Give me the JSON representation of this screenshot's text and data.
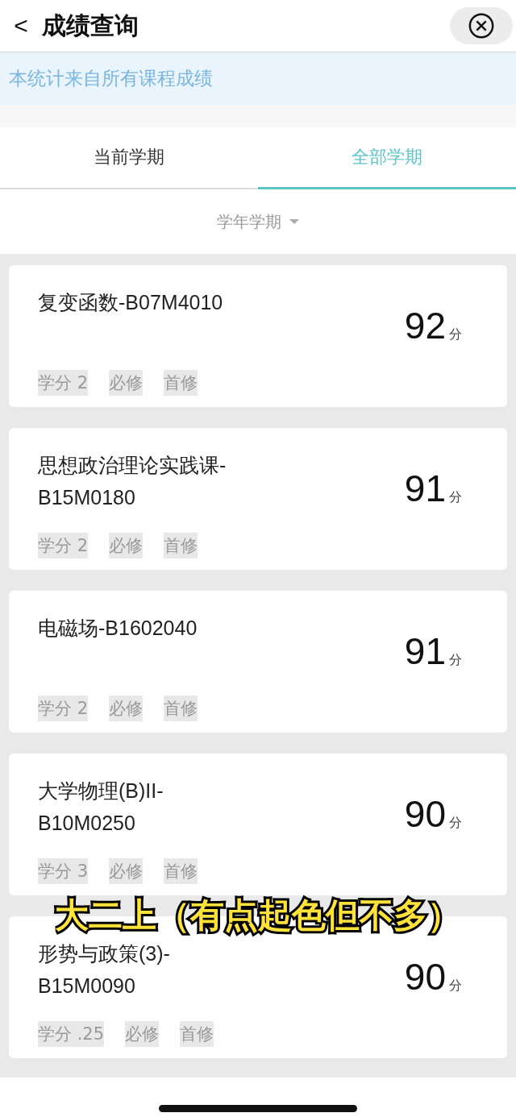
{
  "header": {
    "back": "<",
    "title": "成绩查询"
  },
  "notice": "本统计来自所有课程成绩",
  "tabs": [
    {
      "label": "当前学期",
      "selected": false
    },
    {
      "label": "全部学期",
      "selected": true
    }
  ],
  "filter": {
    "label": "学年学期"
  },
  "courses": [
    {
      "name": "复变函数-B07M4010",
      "score": "92",
      "unit": "分",
      "tags": [
        "学分 2",
        "必修",
        "首修"
      ]
    },
    {
      "name": "思想政治理论实践课-B15M0180",
      "score": "91",
      "unit": "分",
      "tags": [
        "学分 2",
        "必修",
        "首修"
      ]
    },
    {
      "name": "电磁场-B1602040",
      "score": "91",
      "unit": "分",
      "tags": [
        "学分 2",
        "必修",
        "首修"
      ]
    },
    {
      "name": "大学物理(B)II-B10M0250",
      "score": "90",
      "unit": "分",
      "tags": [
        "学分 3",
        "必修",
        "首修"
      ]
    },
    {
      "name": "形势与政策(3)-B15M0090",
      "score": "90",
      "unit": "分",
      "tags": [
        "学分 .25",
        "必修",
        "首修"
      ]
    }
  ],
  "caption": "大二上（有点起色但不多）"
}
